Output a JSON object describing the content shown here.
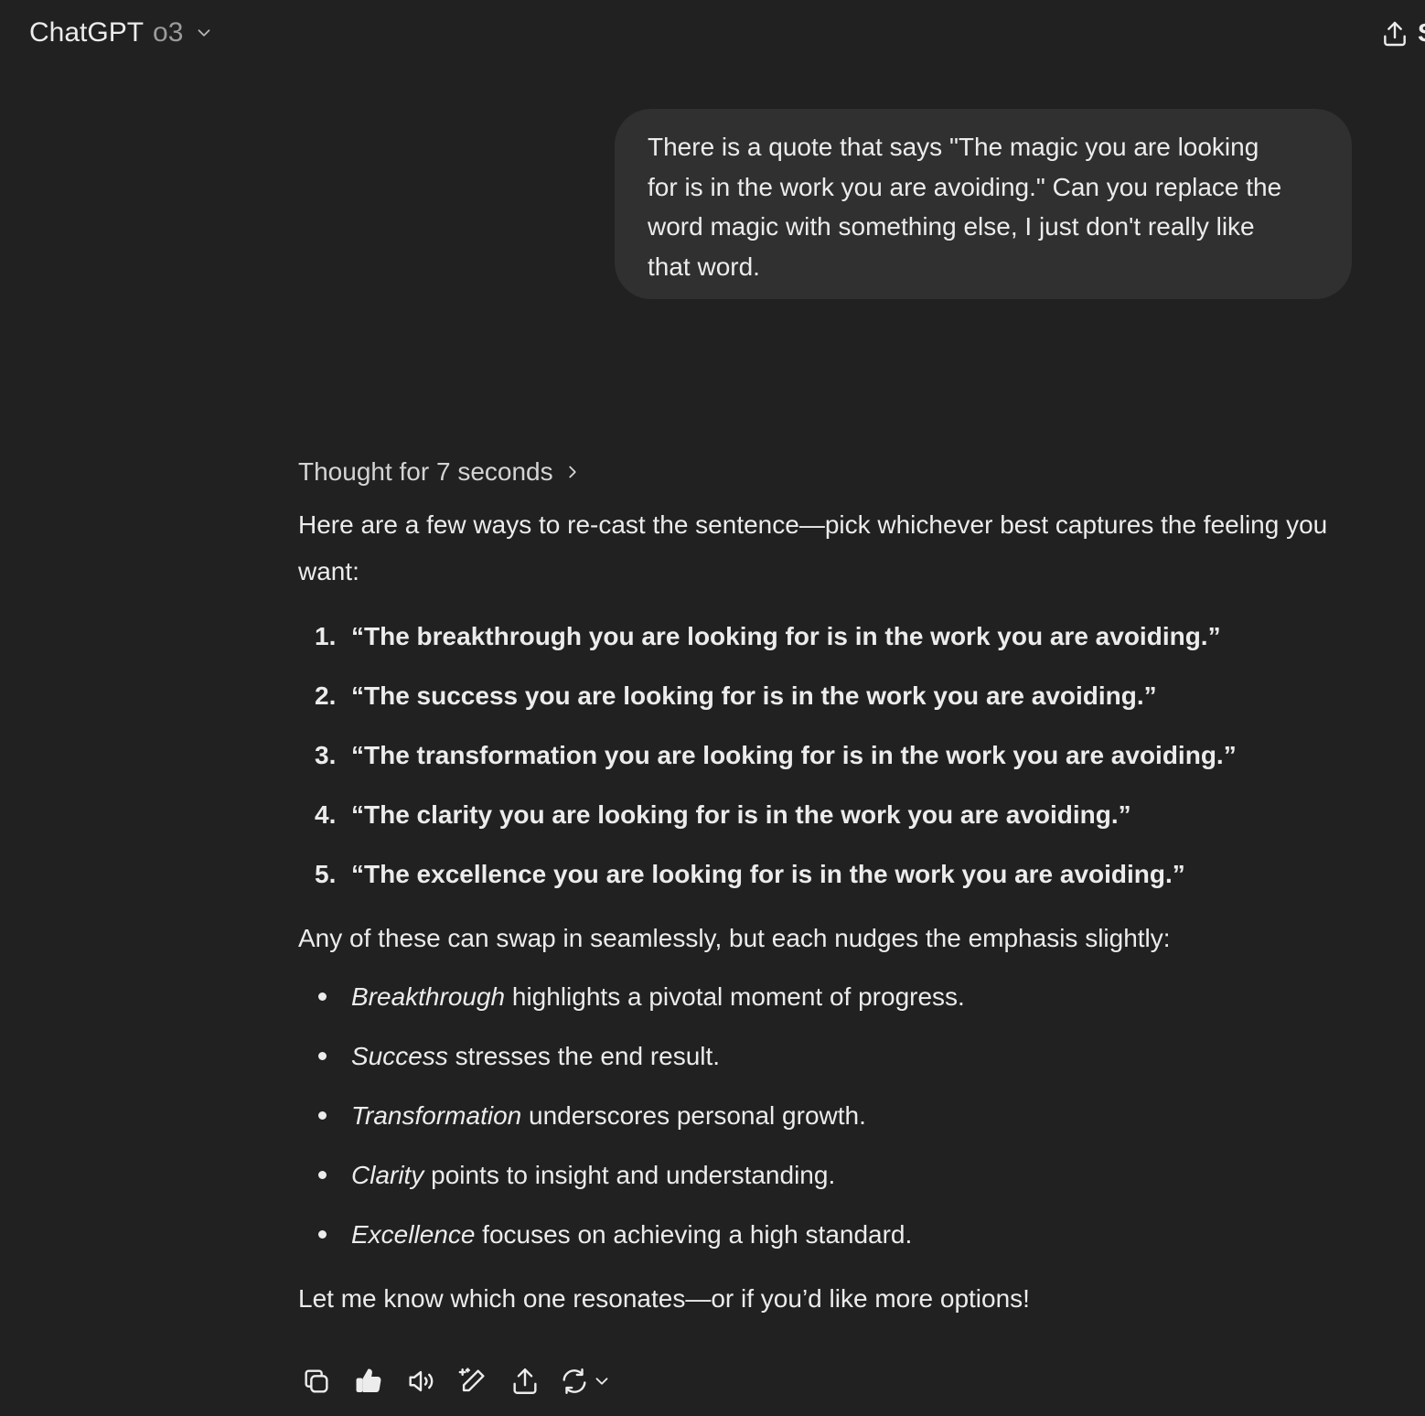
{
  "header": {
    "app_name": "ChatGPT",
    "model": "o3",
    "dropdown_icon": "chevron-down-icon",
    "share_icon": "share-icon",
    "edge_glyph": "S"
  },
  "user_message": {
    "text": "There is a quote that says \"The magic you are looking\nfor is in the work you are avoiding.\" Can you replace the\nword magic with something else, I just don't really like\nthat word."
  },
  "assistant": {
    "thought_label": "Thought for 7 seconds",
    "intro": "Here are a few ways to re-cast the sentence—pick whichever best captures the feeling you want:",
    "options": [
      {
        "num": "1.",
        "text": "“The breakthrough you are looking for is in the work you are avoiding.”"
      },
      {
        "num": "2.",
        "text": "“The success you are looking for is in the work you are avoiding.”"
      },
      {
        "num": "3.",
        "text": "“The transformation you are looking for is in the work you are avoiding.”"
      },
      {
        "num": "4.",
        "text": "“The clarity you are looking for is in the work you are avoiding.”"
      },
      {
        "num": "5.",
        "text": "“The excellence you are looking for is in the work you are avoiding.”"
      }
    ],
    "summary": "Any of these can swap in seamlessly, but each nudges the emphasis slightly:",
    "notes": [
      {
        "term": "Breakthrough",
        "desc": " highlights a pivotal moment of progress."
      },
      {
        "term": "Success",
        "desc": " stresses the end result."
      },
      {
        "term": "Transformation",
        "desc": " underscores personal growth."
      },
      {
        "term": "Clarity",
        "desc": " points to insight and understanding."
      },
      {
        "term": "Excellence",
        "desc": " focuses on achieving a high standard."
      }
    ],
    "closing": "Let me know which one resonates—or if you’d like more options!"
  },
  "actions": {
    "icons": [
      "copy-icon",
      "thumbs-up-icon",
      "read-aloud-icon",
      "edit-icon",
      "share-icon",
      "regenerate-icon"
    ]
  },
  "colors": {
    "background": "#212121",
    "bubble": "#303030",
    "text": "#ececec",
    "muted": "#9b9b9b"
  }
}
